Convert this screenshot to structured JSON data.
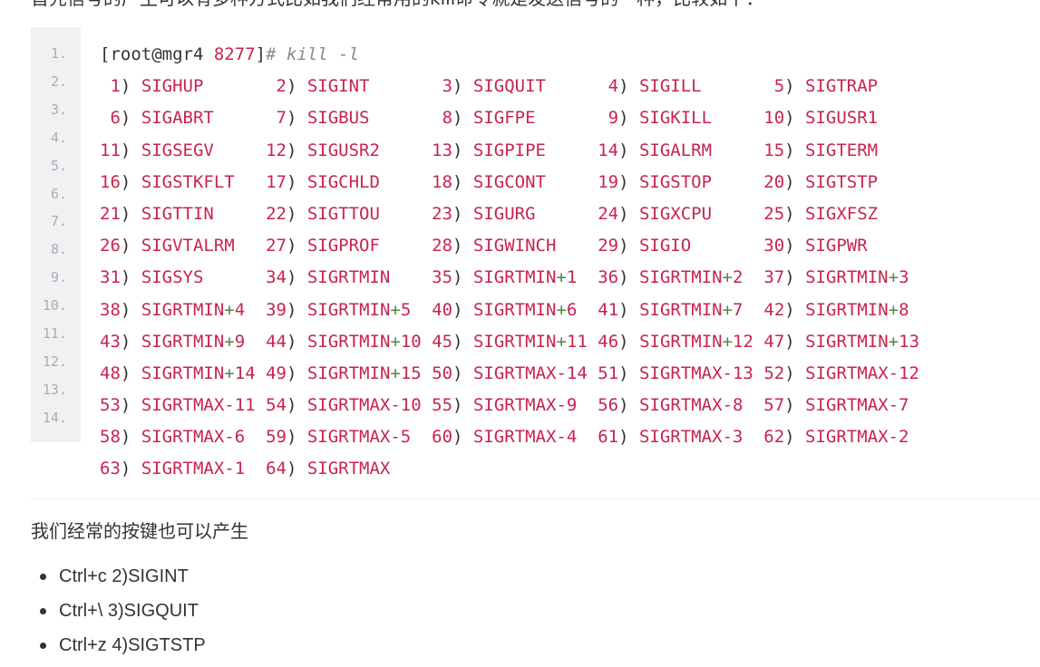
{
  "intro_text": "首先信号的产生可以有多种方式比如我们经常用的kill命令就是发送信号的一种，比较如下：",
  "code": {
    "line_numbers": [
      "1.",
      "2.",
      "3.",
      "4.",
      "5.",
      "6.",
      "7.",
      "8.",
      "9.",
      "10.",
      "11.",
      "12.",
      "13.",
      "14."
    ],
    "prompt": {
      "open": "[",
      "user_host": "root@mgr4",
      "dir": " 8277",
      "close": "]",
      "command": "# kill -l"
    },
    "signal_rows": [
      [
        [
          "1",
          "SIGHUP"
        ],
        [
          "2",
          "SIGINT"
        ],
        [
          "3",
          "SIGQUIT"
        ],
        [
          "4",
          "SIGILL"
        ],
        [
          "5",
          "SIGTRAP"
        ]
      ],
      [
        [
          "6",
          "SIGABRT"
        ],
        [
          "7",
          "SIGBUS"
        ],
        [
          "8",
          "SIGFPE"
        ],
        [
          "9",
          "SIGKILL"
        ],
        [
          "10",
          "SIGUSR1"
        ]
      ],
      [
        [
          "11",
          "SIGSEGV"
        ],
        [
          "12",
          "SIGUSR2"
        ],
        [
          "13",
          "SIGPIPE"
        ],
        [
          "14",
          "SIGALRM"
        ],
        [
          "15",
          "SIGTERM"
        ]
      ],
      [
        [
          "16",
          "SIGSTKFLT"
        ],
        [
          "17",
          "SIGCHLD"
        ],
        [
          "18",
          "SIGCONT"
        ],
        [
          "19",
          "SIGSTOP"
        ],
        [
          "20",
          "SIGTSTP"
        ]
      ],
      [
        [
          "21",
          "SIGTTIN"
        ],
        [
          "22",
          "SIGTTOU"
        ],
        [
          "23",
          "SIGURG"
        ],
        [
          "24",
          "SIGXCPU"
        ],
        [
          "25",
          "SIGXFSZ"
        ]
      ],
      [
        [
          "26",
          "SIGVTALRM"
        ],
        [
          "27",
          "SIGPROF"
        ],
        [
          "28",
          "SIGWINCH"
        ],
        [
          "29",
          "SIGIO"
        ],
        [
          "30",
          "SIGPWR"
        ]
      ],
      [
        [
          "31",
          "SIGSYS"
        ],
        [
          "34",
          "SIGRTMIN"
        ],
        [
          "35",
          "SIGRTMIN+1"
        ],
        [
          "36",
          "SIGRTMIN+2"
        ],
        [
          "37",
          "SIGRTMIN+3"
        ]
      ],
      [
        [
          "38",
          "SIGRTMIN+4"
        ],
        [
          "39",
          "SIGRTMIN+5"
        ],
        [
          "40",
          "SIGRTMIN+6"
        ],
        [
          "41",
          "SIGRTMIN+7"
        ],
        [
          "42",
          "SIGRTMIN+8"
        ]
      ],
      [
        [
          "43",
          "SIGRTMIN+9"
        ],
        [
          "44",
          "SIGRTMIN+10"
        ],
        [
          "45",
          "SIGRTMIN+11"
        ],
        [
          "46",
          "SIGRTMIN+12"
        ],
        [
          "47",
          "SIGRTMIN+13"
        ]
      ],
      [
        [
          "48",
          "SIGRTMIN+14"
        ],
        [
          "49",
          "SIGRTMIN+15"
        ],
        [
          "50",
          "SIGRTMAX-14"
        ],
        [
          "51",
          "SIGRTMAX-13"
        ],
        [
          "52",
          "SIGRTMAX-12"
        ]
      ],
      [
        [
          "53",
          "SIGRTMAX-11"
        ],
        [
          "54",
          "SIGRTMAX-10"
        ],
        [
          "55",
          "SIGRTMAX-9"
        ],
        [
          "56",
          "SIGRTMAX-8"
        ],
        [
          "57",
          "SIGRTMAX-7"
        ]
      ],
      [
        [
          "58",
          "SIGRTMAX-6"
        ],
        [
          "59",
          "SIGRTMAX-5"
        ],
        [
          "60",
          "SIGRTMAX-4"
        ],
        [
          "61",
          "SIGRTMAX-3"
        ],
        [
          "62",
          "SIGRTMAX-2"
        ]
      ],
      [
        [
          "63",
          "SIGRTMAX-1"
        ],
        [
          "64",
          "SIGRTMAX"
        ]
      ]
    ]
  },
  "paragraph": "我们经常的按键也可以产生",
  "bullets": [
    "Ctrl+c 2)SIGINT",
    "Ctrl+\\ 3)SIGQUIT",
    "Ctrl+z 4)SIGTSTP"
  ],
  "colors": {
    "number": "#c7254e",
    "signal": "#c7254e",
    "plus": "#4e8a3a",
    "gutter": "#f0f1f2"
  }
}
